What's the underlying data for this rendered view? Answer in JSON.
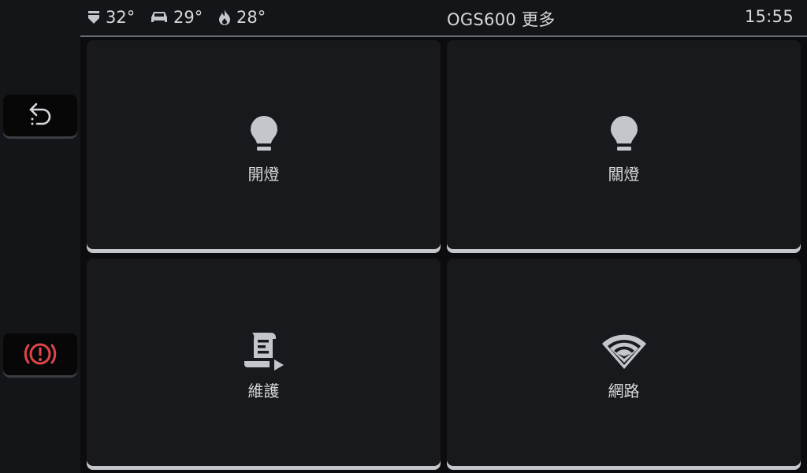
{
  "status": {
    "stat1": {
      "icon": "shovel-down-icon",
      "value": "32°"
    },
    "stat2": {
      "icon": "car-seat-icon",
      "value": "29°"
    },
    "stat3": {
      "icon": "flame-icon",
      "value": "28°"
    }
  },
  "header": {
    "title": "OGS600 更多",
    "time": "15:55"
  },
  "sidebar": {
    "back": {
      "icon": "undo-icon"
    },
    "alarm": {
      "icon": "brake-warning-icon",
      "color": "#e0454a"
    }
  },
  "tiles": [
    {
      "label": "開燈",
      "icon": "lightbulb-icon"
    },
    {
      "label": "關燈",
      "icon": "lightbulb-icon"
    },
    {
      "label": "維護",
      "icon": "script-play-icon"
    },
    {
      "label": "網路",
      "icon": "wifi-icon"
    }
  ],
  "colors": {
    "background": "#141519",
    "tile": "#18191d",
    "accent_bar": "#c3c7cc",
    "icon": "#c3c7cc",
    "alarm": "#e0454a"
  }
}
